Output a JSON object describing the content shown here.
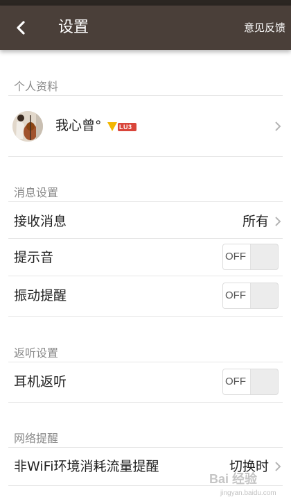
{
  "header": {
    "title": "设置",
    "feedback_label": "意见反馈",
    "back_icon": "chevron-left-icon"
  },
  "profile": {
    "section_label": "个人资料",
    "nickname": "我心曾°",
    "level_badge": "LU3"
  },
  "messages": {
    "section_label": "消息设置",
    "receive_label": "接收消息",
    "receive_value": "所有",
    "sound_label": "提示音",
    "sound_toggle": "OFF",
    "vibrate_label": "振动提醒",
    "vibrate_toggle": "OFF"
  },
  "monitor": {
    "section_label": "返听设置",
    "earphone_label": "耳机返听",
    "earphone_toggle": "OFF"
  },
  "network": {
    "section_label": "网络提醒",
    "traffic_label": "非WiFi环境消耗流量提醒",
    "traffic_value": "切换时"
  },
  "watermark": {
    "text": "Bai 经验",
    "url": "jingyan.baidu.com"
  },
  "colors": {
    "topbar": "#4a3f39",
    "statusbar": "#2b2622",
    "badge_yellow": "#f2b600",
    "badge_red": "#d9453a"
  }
}
